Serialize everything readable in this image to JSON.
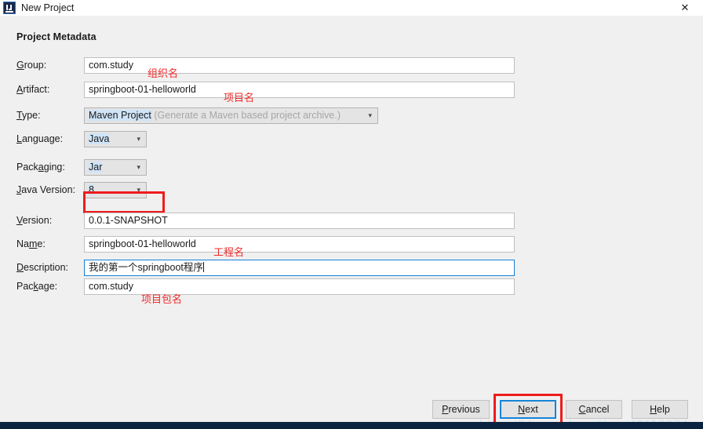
{
  "window": {
    "title": "New Project",
    "app_icon": "intellij-idea-icon",
    "close_icon": "✕"
  },
  "section": {
    "title": "Project Metadata"
  },
  "fields": [
    {
      "key": "group",
      "label_pre": "",
      "label_mnemonic": "G",
      "label_post": "roup:",
      "type": "text",
      "value": "com.study",
      "annotation": "组织名"
    },
    {
      "key": "artifact",
      "label_pre": "",
      "label_mnemonic": "A",
      "label_post": "rtifact:",
      "type": "text",
      "value": "springboot-01-helloworld",
      "annotation": "项目名"
    },
    {
      "key": "type",
      "label_pre": "",
      "label_mnemonic": "T",
      "label_post": "ype:",
      "type": "combo",
      "value": "Maven Project",
      "hint": "(Generate a Maven based project archive.)",
      "annotation": ""
    },
    {
      "key": "language",
      "label_pre": "",
      "label_mnemonic": "L",
      "label_post": "anguage:",
      "type": "combo",
      "value": "Java",
      "annotation": ""
    },
    {
      "key": "packaging",
      "label_pre": "Pack",
      "label_mnemonic": "a",
      "label_post": "ging:",
      "type": "combo",
      "value": "Jar",
      "annotation": ""
    },
    {
      "key": "javaversion",
      "label_pre": "",
      "label_mnemonic": "J",
      "label_post": "ava Version:",
      "type": "combo",
      "value": "8",
      "annotation": ""
    },
    {
      "key": "version",
      "label_pre": "",
      "label_mnemonic": "V",
      "label_post": "ersion:",
      "type": "text",
      "value": "0.0.1-SNAPSHOT",
      "annotation": ""
    },
    {
      "key": "name",
      "label_pre": "Na",
      "label_mnemonic": "m",
      "label_post": "e:",
      "type": "text",
      "value": "springboot-01-helloworld",
      "annotation": "工程名"
    },
    {
      "key": "description",
      "label_pre": "",
      "label_mnemonic": "D",
      "label_post": "escription:",
      "type": "text",
      "value": "我的第一个springboot程序",
      "annotation": "",
      "focused": true
    },
    {
      "key": "package",
      "label_pre": "Pac",
      "label_mnemonic": "k",
      "label_post": "age:",
      "type": "text",
      "value": "com.study",
      "annotation": "项目包名"
    }
  ],
  "buttons": {
    "previous": {
      "pre": "",
      "mnemonic": "P",
      "post": "revious"
    },
    "next": {
      "pre": "",
      "mnemonic": "N",
      "post": "ext"
    },
    "cancel": {
      "pre": "",
      "mnemonic": "C",
      "post": "ancel"
    },
    "help": {
      "pre": "",
      "mnemonic": "H",
      "post": "elp"
    }
  },
  "watermark": "https://blog.csdn.net/qq_46112274",
  "colors": {
    "accent_blue": "#1585d8",
    "annotation_red": "#ee1c1c",
    "window_bg": "#f0f0f0",
    "bottom_bar": "#0c2340"
  }
}
